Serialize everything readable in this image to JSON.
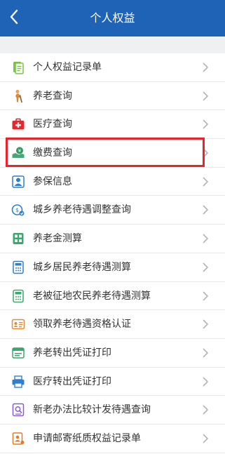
{
  "header": {
    "title": "个人权益",
    "back_icon": "chevron-left-icon",
    "background_color": "#1e63b6"
  },
  "menu": {
    "items": [
      {
        "label": "个人权益记录单",
        "icon": "record-document-icon"
      },
      {
        "label": "养老查询",
        "icon": "elderly-person-icon"
      },
      {
        "label": "医疗查询",
        "icon": "medical-kit-icon"
      },
      {
        "label": "缴费查询",
        "icon": "payment-icon"
      },
      {
        "label": "参保信息",
        "icon": "insurance-info-icon"
      },
      {
        "label": "城乡养老待遇调整查询",
        "icon": "pension-adjust-icon"
      },
      {
        "label": "养老金测算",
        "icon": "calculator-icon"
      },
      {
        "label": "城乡居民养老待遇测算",
        "icon": "resident-calculator-icon"
      },
      {
        "label": "老被征地农民养老待遇测算",
        "icon": "land-calculator-icon"
      },
      {
        "label": "领取养老待遇资格认证",
        "icon": "id-card-icon"
      },
      {
        "label": "养老转出凭证打印",
        "icon": "pension-transfer-print-icon"
      },
      {
        "label": "医疗转出凭证打印",
        "icon": "printer-icon"
      },
      {
        "label": "新老办法比较计发待遇查询",
        "icon": "compare-search-icon"
      },
      {
        "label": "申请邮寄纸质权益记录单",
        "icon": "mail-document-icon"
      }
    ],
    "highlighted_item": "缴费查询",
    "highlight_color": "#e8242a"
  }
}
